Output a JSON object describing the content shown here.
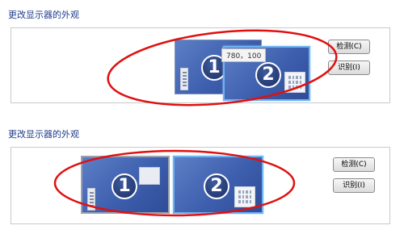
{
  "top": {
    "heading": "更改显示器的外观",
    "tooltip": "780，100",
    "detect_label": "检测(C)",
    "identify_label": "识别(I)",
    "monitor1_number": "1",
    "monitor2_number": "2"
  },
  "bottom": {
    "heading": "更改显示器的外观",
    "detect_label": "检测(C)",
    "identify_label": "识别(I)",
    "monitor1_number": "1",
    "monitor2_number": "2"
  },
  "colors": {
    "heading": "#1e3b8a",
    "monitor_blue": "#3d5fae",
    "selection_outline": "#6fb3f2",
    "annotation_ellipse": "#e01010"
  }
}
